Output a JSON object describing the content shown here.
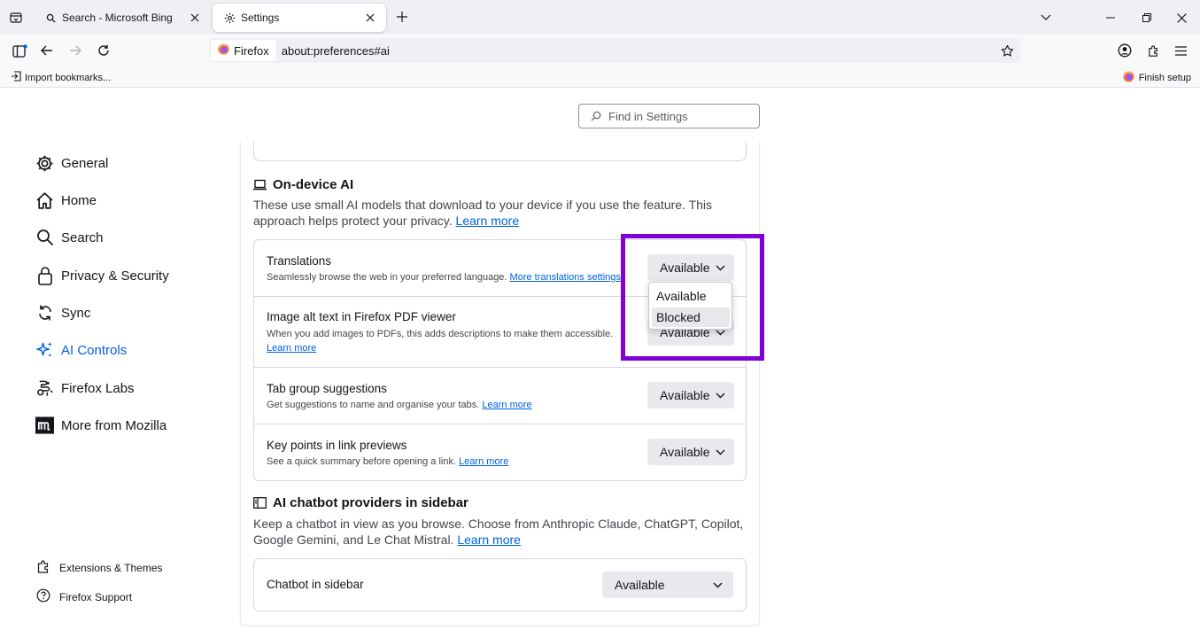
{
  "browser": {
    "tabs": [
      {
        "title": "Search - Microsoft Bing",
        "icon": "search-icon"
      },
      {
        "title": "Settings",
        "icon": "gear-icon",
        "active": true
      }
    ],
    "identity_label": "Firefox",
    "url": "about:preferences#ai",
    "bookmarks": {
      "import": "Import bookmarks...",
      "finish": "Finish setup"
    }
  },
  "search": {
    "placeholder": "Find in Settings"
  },
  "sidebar": {
    "items": [
      {
        "label": "General",
        "icon": "gear-icon"
      },
      {
        "label": "Home",
        "icon": "home-icon"
      },
      {
        "label": "Search",
        "icon": "search-icon"
      },
      {
        "label": "Privacy & Security",
        "icon": "lock-icon"
      },
      {
        "label": "Sync",
        "icon": "sync-icon"
      },
      {
        "label": "AI Controls",
        "icon": "sparkle-icon",
        "active": true
      },
      {
        "label": "Firefox Labs",
        "icon": "labs-icon"
      },
      {
        "label": "More from Mozilla",
        "icon": "mozilla-icon"
      }
    ],
    "footer": [
      {
        "label": "Extensions & Themes",
        "icon": "puzzle-icon"
      },
      {
        "label": "Firefox Support",
        "icon": "help-icon"
      }
    ]
  },
  "on_device": {
    "title": "On-device AI",
    "desc": "These use small AI models that download to your device if you use the feature. This approach helps protect your privacy.",
    "learn_more": "Learn more",
    "rows": [
      {
        "label": "Translations",
        "sub": "Seamlessly browse the web in your preferred language.",
        "link": "More translations settings",
        "value": "Available"
      },
      {
        "label": "Image alt text in Firefox PDF viewer",
        "sub": "When you add images to PDFs, this adds descriptions to make them accessible.",
        "link": "Learn more",
        "value": "Available"
      },
      {
        "label": "Tab group suggestions",
        "sub": "Get suggestions to name and organise your tabs.",
        "link": "Learn more",
        "value": "Available"
      },
      {
        "label": "Key points in link previews",
        "sub": "See a quick summary before opening a link.",
        "link": "Learn more",
        "value": "Available"
      }
    ]
  },
  "chatbot": {
    "title": "AI chatbot providers in sidebar",
    "desc": "Keep a chatbot in view as you browse. Choose from Anthropic Claude, ChatGPT, Copilot, Google Gemini, and Le Chat Mistral.",
    "learn_more": "Learn more",
    "row": {
      "label": "Chatbot in sidebar",
      "value": "Available"
    }
  },
  "dropdown": {
    "options": [
      "Available",
      "Blocked"
    ],
    "hovered": "Blocked"
  },
  "colors": {
    "accent": "#0061e0",
    "highlight": "#8000d7"
  }
}
